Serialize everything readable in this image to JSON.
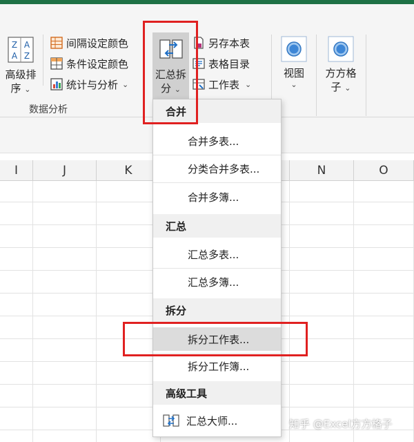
{
  "ribbon": {
    "sort_button": {
      "line1": "高级排",
      "line2": "序",
      "icon_top": "Z A",
      "icon_bottom": "A Z"
    },
    "interval_color": "间隔设定颜色",
    "condition_color": "条件设定颜色",
    "stats_analysis": "统计与分析",
    "group_label": "数据分析",
    "summary_split": {
      "line1": "汇总拆",
      "line2": "分"
    },
    "save_table": "另存本表",
    "table_catalog": "表格目录",
    "worksheet": "工作表",
    "view": "视图",
    "fangfang": {
      "line1": "方方格",
      "line2": "子"
    }
  },
  "columns": [
    {
      "label": "I",
      "width": 48
    },
    {
      "label": "J",
      "width": 92
    },
    {
      "label": "K",
      "width": 93
    },
    {
      "label": "",
      "width": 187
    },
    {
      "label": "N",
      "width": 93
    },
    {
      "label": "O",
      "width": 87
    }
  ],
  "menu": {
    "merge_header": "合并",
    "merge_multi_table": "合并多表...",
    "category_merge": "分类合并多表...",
    "merge_multi_book": "合并多簿...",
    "summary_header": "汇总",
    "summary_multi_table": "汇总多表...",
    "summary_multi_book": "汇总多簿...",
    "split_header": "拆分",
    "split_worksheet": "拆分工作表...",
    "split_workbook": "拆分工作簿...",
    "advanced_header": "高级工具",
    "summary_master": "汇总大师..."
  },
  "watermark": "知乎 @Excel方方格子",
  "colors": {
    "accent_green": "#1e7145",
    "highlight_red": "#e02020",
    "menu_hover": "#dcdcdc"
  }
}
